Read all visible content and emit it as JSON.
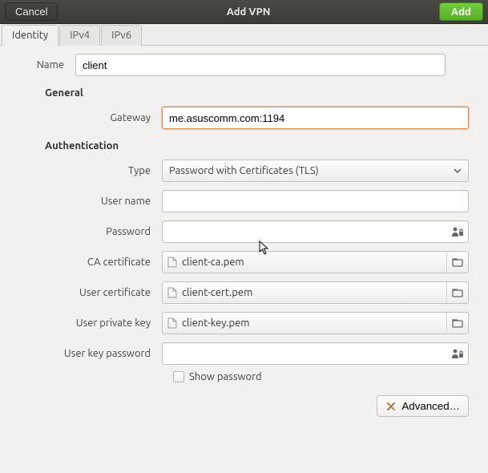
{
  "titlebar": {
    "cancel": "Cancel",
    "title": "Add VPN",
    "add": "Add"
  },
  "tabs": {
    "identity": "Identity",
    "ipv4": "IPv4",
    "ipv6": "IPv6"
  },
  "labels": {
    "name": "Name",
    "general": "General",
    "gateway": "Gateway",
    "authentication": "Authentication",
    "type": "Type",
    "username": "User name",
    "password": "Password",
    "ca": "CA certificate",
    "usercert": "User certificate",
    "userkey": "User private key",
    "userkeypwd": "User key password",
    "show_password": "Show password",
    "advanced": "Advanced…"
  },
  "values": {
    "name": "client",
    "gateway": "me.asuscomm.com:1194",
    "type": "Password with Certificates (TLS)",
    "username": "",
    "password": "",
    "ca_file": "client-ca.pem",
    "usercert_file": "client-cert.pem",
    "userkey_file": "client-key.pem",
    "userkeypwd": ""
  }
}
